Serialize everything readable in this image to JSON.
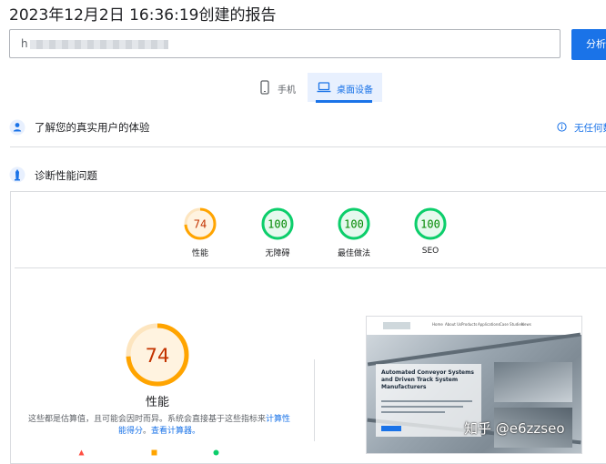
{
  "report": {
    "title": "2023年12月2日 16:36:19创建的报告"
  },
  "url_input": {
    "value": "h"
  },
  "analyze_button": {
    "label": "分析"
  },
  "tabs": [
    {
      "label": "手机",
      "icon": "phone-icon",
      "selected": false
    },
    {
      "label": "桌面设备",
      "icon": "laptop-icon",
      "selected": true
    }
  ],
  "field_data": {
    "title": "了解您的真实用户的体验",
    "link": "无任何数"
  },
  "diagnose": {
    "title": "诊断性能问题"
  },
  "scores": [
    {
      "label": "性能",
      "value": "74",
      "status": "average"
    },
    {
      "label": "无障碍",
      "value": "100",
      "status": "pass"
    },
    {
      "label": "最佳做法",
      "value": "100",
      "status": "pass"
    },
    {
      "label": "SEO",
      "value": "100",
      "status": "pass"
    }
  ],
  "performance": {
    "score": "74",
    "title": "性能",
    "note_text": "这些都是估算值，且可能会因时而异。系统会直接基于这些指标来",
    "note_link": "计算性能得分",
    "note_sep": "。",
    "note_link2": "查看计算器。"
  },
  "screenshot": {
    "nav": [
      "Home",
      "About Us",
      "Products",
      "Applications",
      "Case Studies",
      "News"
    ],
    "hero_title": "Automated Conveyor Systems and Driven Track System Manufacturers"
  },
  "colors": {
    "pass": "#0cce6b",
    "pass_text": "#008800",
    "average": "#ffa400",
    "average_text": "#c33300",
    "accent": "#1a73e8"
  },
  "watermark": "知乎 @e6zzseo"
}
